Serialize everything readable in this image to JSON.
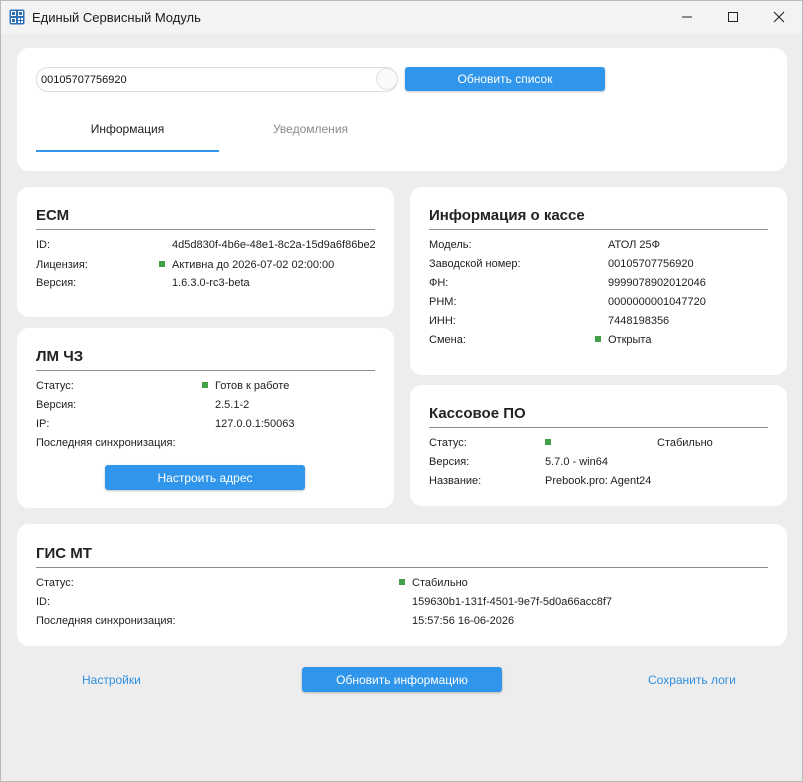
{
  "window": {
    "title": "Единый Сервисный Модуль",
    "app_icon": "qr-code-icon",
    "controls": [
      "minimize-icon",
      "maximize-icon",
      "close-icon"
    ]
  },
  "top": {
    "serial_value": "00105707756920",
    "refresh_list_button": "Обновить список",
    "tabs": [
      {
        "label": "Информация",
        "active": true
      },
      {
        "label": "Уведомления",
        "active": false
      }
    ]
  },
  "ecm": {
    "title": "ЕСМ",
    "rows": [
      {
        "label": "ID:",
        "value": "4d5d830f-4b6e-48e1-8c2a-15d9a6f86be2",
        "status_dot": false
      },
      {
        "label": "Лицензия:",
        "value": "Активна до 2026-07-02 02:00:00",
        "status_dot": true
      },
      {
        "label": "Версия:",
        "value": "1.6.3.0-rc3-beta",
        "status_dot": false
      }
    ]
  },
  "lm": {
    "title": "ЛМ ЧЗ",
    "rows": [
      {
        "label": "Статус:",
        "value": "Готов к работе",
        "status_dot": true
      },
      {
        "label": "Версия:",
        "value": "2.5.1-2",
        "status_dot": false
      },
      {
        "label": "IP:",
        "value": "127.0.0.1:50063",
        "status_dot": false
      },
      {
        "label": "Последняя синхронизация:",
        "value": "",
        "status_dot": false
      }
    ],
    "configure_button": "Настроить адрес"
  },
  "kassa": {
    "title": "Информация о кассе",
    "rows": [
      {
        "label": "Модель:",
        "value": "АТОЛ 25Ф",
        "status_dot": false
      },
      {
        "label": "Заводской номер:",
        "value": "00105707756920",
        "status_dot": false
      },
      {
        "label": "ФН:",
        "value": "9999078902012046",
        "status_dot": false
      },
      {
        "label": "РНМ:",
        "value": "0000000001047720",
        "status_dot": false
      },
      {
        "label": "ИНН:",
        "value": "7448198356",
        "status_dot": false
      },
      {
        "label": "Смена:",
        "value": "Открыта",
        "status_dot": true
      }
    ]
  },
  "po": {
    "title": "Кассовое ПО",
    "rows": [
      {
        "label": "Статус:",
        "value": "Стабильно",
        "status_dot": true
      },
      {
        "label": "Версия:",
        "value": "5.7.0 - win64",
        "status_dot": false
      },
      {
        "label": "Название:",
        "value": "Prebook.pro: Agent24",
        "status_dot": false
      }
    ]
  },
  "gis": {
    "title": "ГИС МТ",
    "rows": [
      {
        "label": "Статус:",
        "value": "Стабильно",
        "status_dot": true
      },
      {
        "label": "ID:",
        "value": "159630b1-131f-4501-9e7f-5d0a66acc8f7",
        "status_dot": false
      },
      {
        "label": "Последняя синхронизация:",
        "value": "15:57:56 16-06-2026",
        "status_dot": false
      }
    ]
  },
  "footer": {
    "settings_link": "Настройки",
    "refresh_info_button": "Обновить информацию",
    "save_logs_link": "Сохранить логи"
  },
  "colors": {
    "accent": "#2f96ec",
    "link": "#2f8fe0",
    "status_ok": "#43a047",
    "background": "#ededed",
    "card": "#ffffff"
  }
}
